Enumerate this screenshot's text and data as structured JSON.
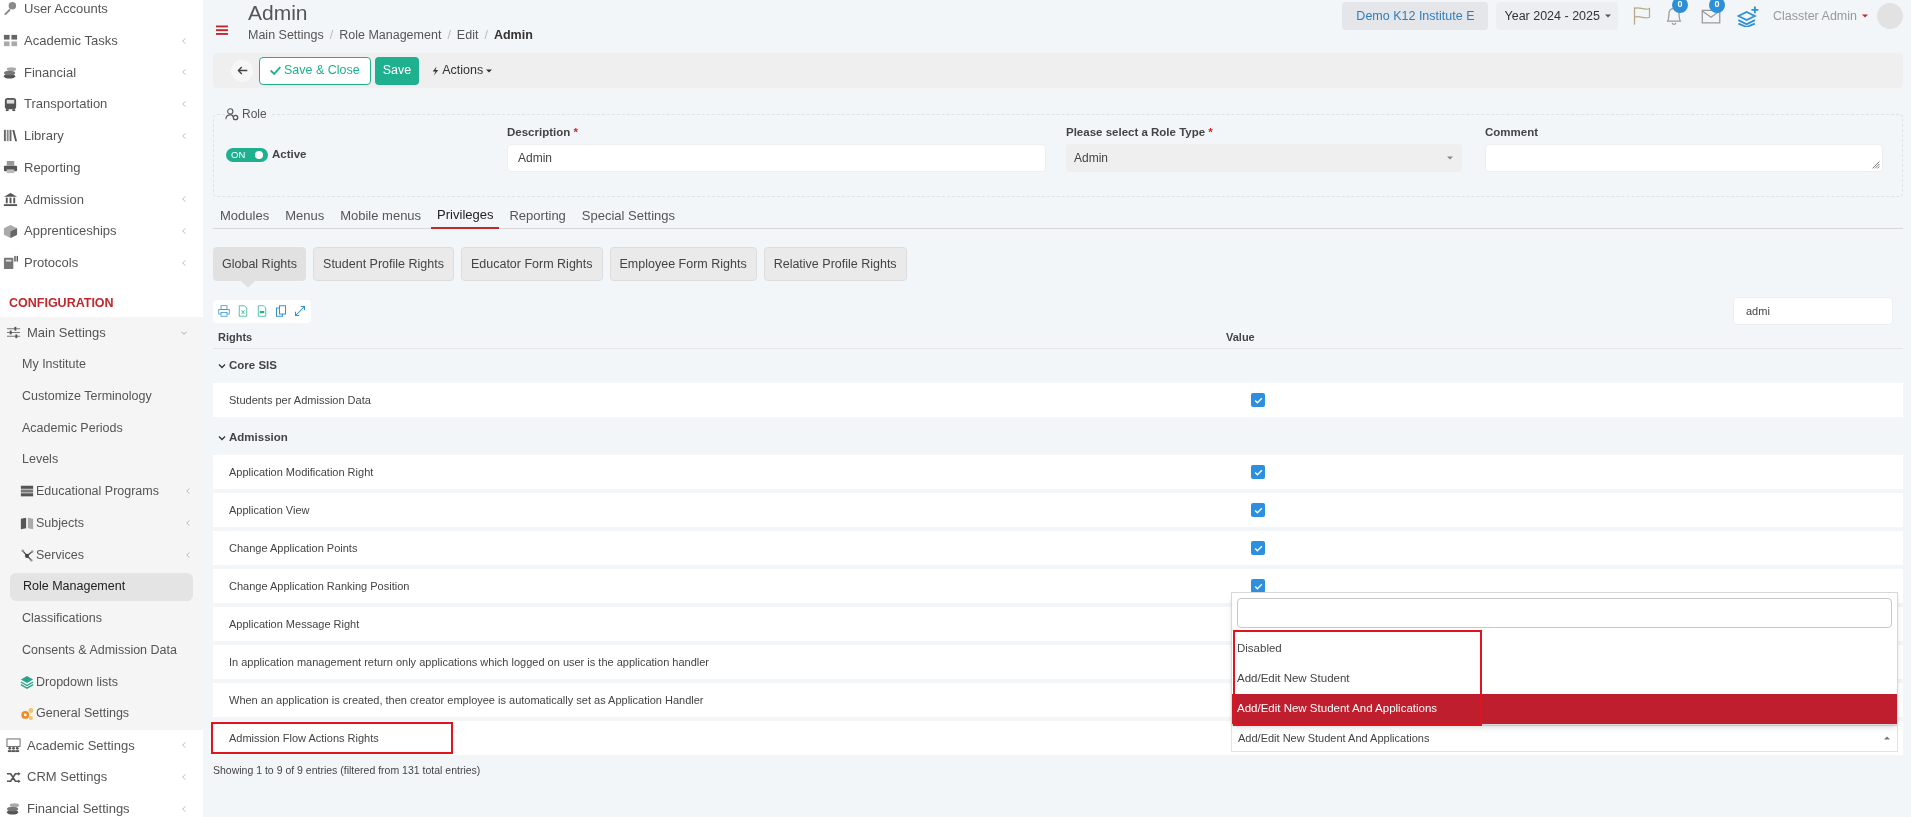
{
  "sidebar": {
    "items": [
      {
        "label": "User Accounts",
        "expandable": false
      },
      {
        "label": "Academic Tasks",
        "expandable": true,
        "expanded": false
      },
      {
        "label": "Financial",
        "expandable": true,
        "expanded": false
      },
      {
        "label": "Transportation",
        "expandable": true,
        "expanded": false
      },
      {
        "label": "Library",
        "expandable": true,
        "expanded": false
      },
      {
        "label": "Reporting",
        "expandable": false
      },
      {
        "label": "Admission",
        "expandable": true,
        "expanded": false
      },
      {
        "label": "Apprenticeships",
        "expandable": true,
        "expanded": false
      },
      {
        "label": "Protocols",
        "expandable": true,
        "expanded": false
      }
    ],
    "section": {
      "title": "CONFIGURATION",
      "items": [
        {
          "label": "Main Settings",
          "expandable": true,
          "expanded": true,
          "children": [
            {
              "label": "My Institute",
              "selected": false,
              "expandable": false
            },
            {
              "label": "Customize Terminology",
              "selected": false,
              "expandable": false
            },
            {
              "label": "Academic Periods",
              "selected": false,
              "expandable": false
            },
            {
              "label": "Levels",
              "selected": false,
              "expandable": false
            },
            {
              "label": "Educational Programs",
              "selected": false,
              "expandable": true,
              "expanded": false
            },
            {
              "label": "Subjects",
              "selected": false,
              "expandable": true,
              "expanded": false
            },
            {
              "label": "Services",
              "selected": false,
              "expandable": true,
              "expanded": false
            },
            {
              "label": "Role Management",
              "selected": true,
              "expandable": false
            },
            {
              "label": "Classifications",
              "selected": false,
              "expandable": false
            },
            {
              "label": "Consents & Admission Data",
              "selected": false,
              "expandable": false
            },
            {
              "label": "Dropdown lists",
              "selected": false,
              "expandable": false
            },
            {
              "label": "General Settings",
              "selected": false,
              "expandable": false
            }
          ]
        },
        {
          "label": "Academic Settings",
          "expandable": true,
          "expanded": false
        },
        {
          "label": "CRM Settings",
          "expandable": true,
          "expanded": false
        },
        {
          "label": "Financial Settings",
          "expandable": true,
          "expanded": false
        }
      ]
    }
  },
  "page": {
    "title": "Admin",
    "separator": "/",
    "breadcrumb": [
      "Main Settings",
      "Role Management",
      "Edit",
      "Admin"
    ]
  },
  "topbar": {
    "institute": "Demo K12 Institute E",
    "year": "Year 2024 - 2025",
    "notifications": "0",
    "messages": "0",
    "user": "Classter Admin"
  },
  "toolbar": {
    "buttons": [
      {
        "label": "Save & Close",
        "kind": "outline"
      },
      {
        "label": "Save",
        "kind": "solid"
      }
    ],
    "actions": "Actions"
  },
  "role": {
    "legend": "Role",
    "required_mark": "*",
    "toggle": {
      "label": "ON",
      "on": true
    },
    "active_label": "Active",
    "fields": [
      {
        "label": "Description",
        "required": true,
        "kind": "text",
        "value": "Admin"
      },
      {
        "label": "Please select a Role Type",
        "required": true,
        "kind": "select",
        "value": "Admin"
      },
      {
        "label": "Comment",
        "required": false,
        "kind": "textarea"
      }
    ]
  },
  "tabs": [
    {
      "label": "Modules",
      "selected": false
    },
    {
      "label": "Menus",
      "selected": false
    },
    {
      "label": "Mobile menus",
      "selected": false
    },
    {
      "label": "Privileges",
      "selected": true
    },
    {
      "label": "Reporting",
      "selected": false
    },
    {
      "label": "Special Settings",
      "selected": false
    }
  ],
  "subtabs": [
    {
      "label": "Global Rights",
      "selected": true
    },
    {
      "label": "Student Profile Rights",
      "selected": false
    },
    {
      "label": "Educator Form Rights",
      "selected": false
    },
    {
      "label": "Employee Form Rights",
      "selected": false
    },
    {
      "label": "Relative Profile Rights",
      "selected": false
    }
  ],
  "search": {
    "value": "admi"
  },
  "table": {
    "columns": [
      "Rights",
      "Value"
    ],
    "groups": [
      {
        "title": "Core SIS",
        "expanded": true,
        "rows": [
          {
            "label": "Students per Admission Data",
            "kind": "check",
            "checked": true,
            "highlighted": false
          }
        ]
      },
      {
        "title": "Admission",
        "expanded": true,
        "rows": [
          {
            "label": "Application Modification Right",
            "kind": "check",
            "checked": true,
            "highlighted": false
          },
          {
            "label": "Application View",
            "kind": "check",
            "checked": true,
            "highlighted": false
          },
          {
            "label": "Change Application Points",
            "kind": "check",
            "checked": true,
            "highlighted": false
          },
          {
            "label": "Change Application Ranking Position",
            "kind": "check",
            "checked": true,
            "highlighted": false
          },
          {
            "label": "Application Message Right",
            "kind": "covered",
            "highlighted": false
          },
          {
            "label": "In application management return only applications which logged on user is the application handler",
            "kind": "covered",
            "highlighted": false
          },
          {
            "label": "When an application is created, then creator employee is automatically set as Application Handler",
            "kind": "covered",
            "highlighted": false
          },
          {
            "label": "Admission Flow Actions Rights",
            "kind": "select",
            "value": "Add/Edit New Student And Applications",
            "highlighted": true,
            "dropdown": {
              "highlighted": true,
              "options": [
                {
                  "label": "Disabled",
                  "selected": false
                },
                {
                  "label": "Add/Edit New Student",
                  "selected": false
                },
                {
                  "label": "Add/Edit New Student And Applications",
                  "selected": true
                }
              ]
            }
          }
        ]
      }
    ]
  },
  "status": "Showing 1 to 9 of 9 entries (filtered from 131 total entries)"
}
